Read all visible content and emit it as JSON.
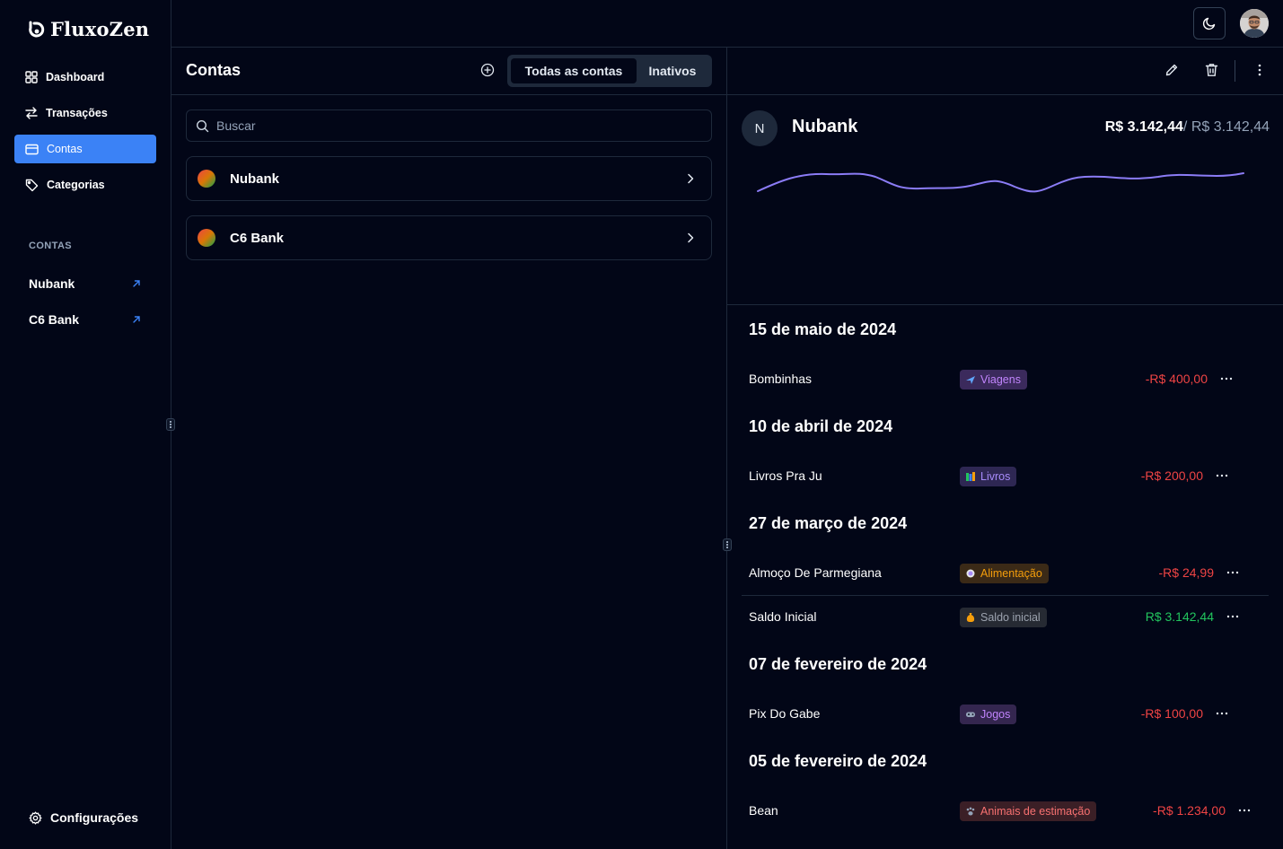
{
  "app": {
    "name": "FluxoZen"
  },
  "sidebar": {
    "items": [
      {
        "label": "Dashboard",
        "icon": "grid-icon",
        "active": false
      },
      {
        "label": "Transações",
        "icon": "arrows-icon",
        "active": false
      },
      {
        "label": "Contas",
        "icon": "card-icon",
        "active": true
      },
      {
        "label": "Categorias",
        "icon": "tag-icon",
        "active": false
      }
    ],
    "section_title": "CONTAS",
    "accounts": [
      "Nubank",
      "C6 Bank"
    ],
    "settings_label": "Configurações"
  },
  "topbar": {
    "theme_icon": "moon-icon"
  },
  "accounts_panel": {
    "title": "Contas",
    "tabs": [
      {
        "label": "Todas as contas",
        "active": true
      },
      {
        "label": "Inativos",
        "active": false
      }
    ],
    "search": {
      "placeholder": "Buscar",
      "value": ""
    },
    "list": [
      "Nubank",
      "C6 Bank"
    ]
  },
  "detail": {
    "avatar_letter": "N",
    "name": "Nubank",
    "balance": "R$ 3.142,44",
    "balance_total": "/ R$ 3.142,44",
    "accent_line_color": "#8b7cf6",
    "groups": [
      {
        "date": "15 de maio de 2024",
        "transactions": [
          {
            "description": "Bombinhas",
            "category": "Viagens",
            "category_color": "#c084fc",
            "category_bg": "#3b2a5c",
            "amount": "-R$ 400,00",
            "type": "negative"
          }
        ]
      },
      {
        "date": "10 de abril de 2024",
        "transactions": [
          {
            "description": "Livros Pra Ju",
            "category": "Livros",
            "category_color": "#a78bfa",
            "category_bg": "#2e2753",
            "amount": "-R$ 200,00",
            "type": "negative"
          }
        ]
      },
      {
        "date": "27 de março de 2024",
        "transactions": [
          {
            "description": "Almoço De Parmegiana",
            "category": "Alimentação",
            "category_color": "#f59e0b",
            "category_bg": "#3b2a17",
            "amount": "-R$ 24,99",
            "type": "negative"
          },
          {
            "description": "Saldo Inicial",
            "category": "Saldo inicial",
            "category_color": "#9ca3af",
            "category_bg": "#262a33",
            "amount": "R$ 3.142,44",
            "type": "positive"
          }
        ]
      },
      {
        "date": "07 de fevereiro de 2024",
        "transactions": [
          {
            "description": "Pix Do Gabe",
            "category": "Jogos",
            "category_color": "#c084fc",
            "category_bg": "#34264f",
            "amount": "-R$ 100,00",
            "type": "negative"
          }
        ]
      },
      {
        "date": "05 de fevereiro de 2024",
        "transactions": [
          {
            "description": "Bean",
            "category": "Animais de estimação",
            "category_color": "#f87171",
            "category_bg": "#3b1f26",
            "amount": "-R$ 1.234,00",
            "type": "negative"
          }
        ]
      }
    ]
  },
  "colors": {
    "accent": "#3b82f6",
    "negative": "#ef4444",
    "positive": "#22c55e",
    "background": "#020617"
  }
}
